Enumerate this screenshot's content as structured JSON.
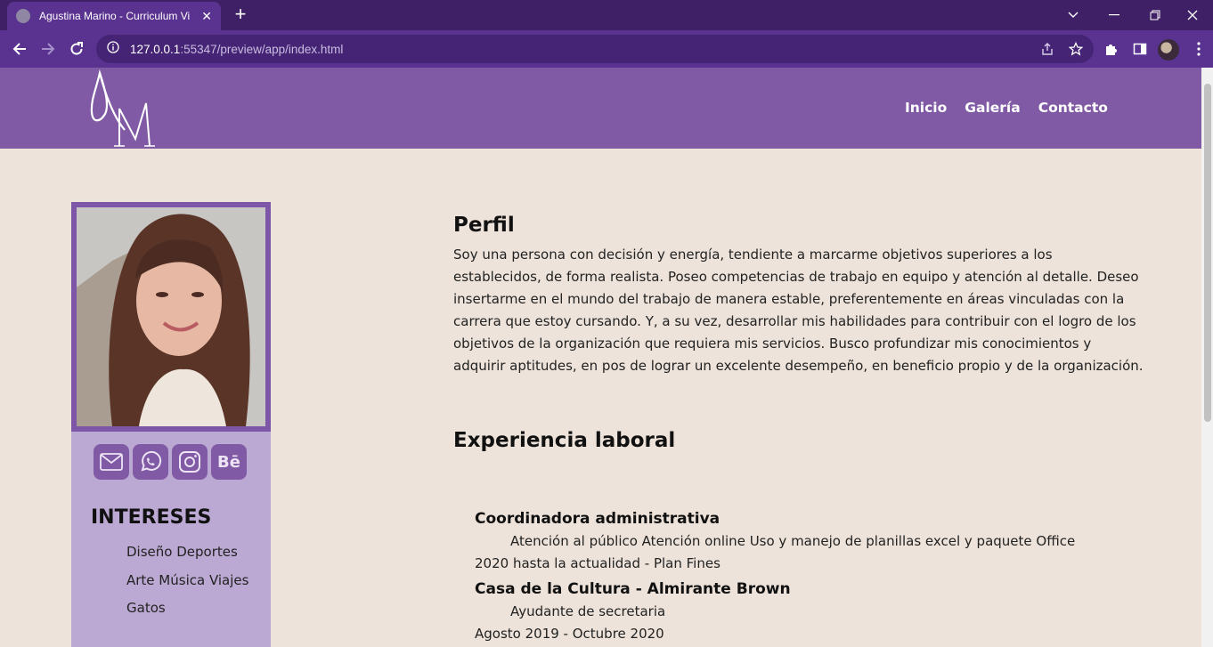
{
  "browser": {
    "tab_title": "Agustina Marino - Curriculum Vi",
    "url_host": "127.0.0.1",
    "url_rest": ":55347/preview/app/index.html"
  },
  "header": {
    "logo_text": "AM",
    "nav": [
      "Inicio",
      "Galería",
      "Contacto"
    ]
  },
  "sidebar": {
    "socials": [
      "mail-icon",
      "whatsapp-icon",
      "instagram-icon",
      "behance-icon"
    ],
    "behance_label": "Bē",
    "intereses_title": "INTERESES",
    "intereses": [
      "Diseño Deportes",
      "Arte Música Viajes",
      "Gatos"
    ]
  },
  "perfil": {
    "title": "Perfil",
    "text": "Soy una persona con decisión y energía, tendiente a marcarme objetivos superiores a los establecidos, de forma realista. Poseo competencias de trabajo en equipo y atención al detalle. Deseo insertarme en el mundo del trabajo de manera estable, preferentemente en áreas vinculadas con la carrera que estoy cursando. Y, a su vez, desarrollar mis habilidades para contribuir con el logro de los objetivos de la organización que requiera mis servicios. Busco profundizar mis conocimientos y adquirir aptitudes, en pos de lograr un excelente desempeño, en beneficio propio y de la organización."
  },
  "experiencia": {
    "title": "Experiencia laboral",
    "jobs": [
      {
        "title": "Coordinadora administrativa",
        "description": "Atención al público Atención online Uso y manejo de planillas excel y paquete Office",
        "period": "2020 hasta la actualidad - Plan Fines"
      },
      {
        "title": "Casa de la Cultura - Almirante Brown",
        "description": "Ayudante de secretaria",
        "period": "Agosto 2019 - Octubre 2020"
      }
    ]
  }
}
